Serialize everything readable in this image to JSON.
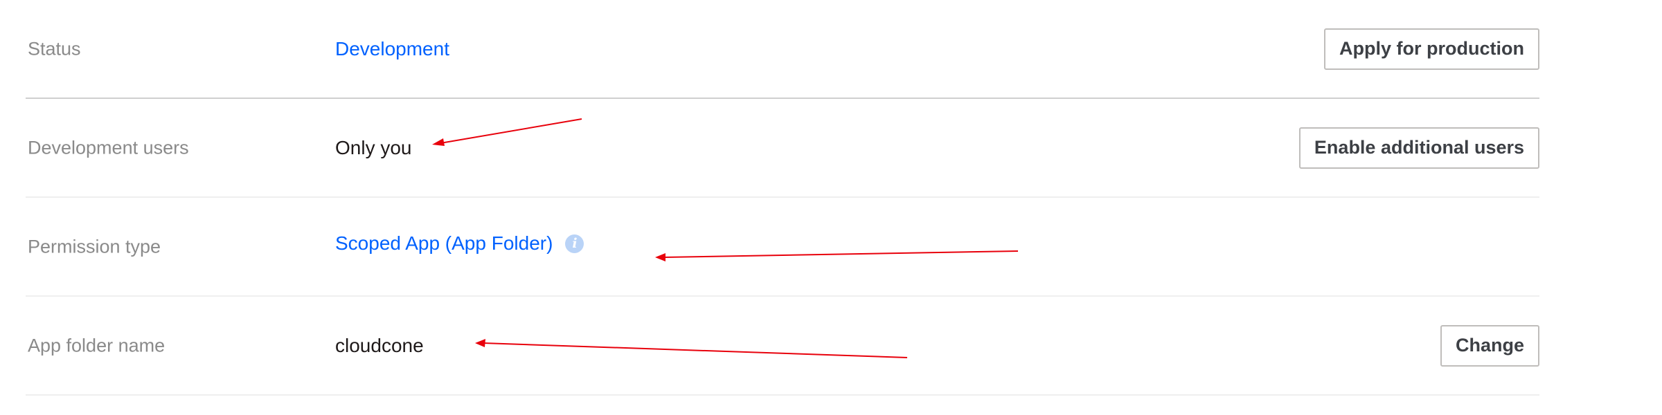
{
  "rows": [
    {
      "label": "Status",
      "value": "Development",
      "button": "Apply for production"
    },
    {
      "label": "Development users",
      "value": "Only you",
      "button": "Enable additional users"
    },
    {
      "label": "Permission type",
      "value": "Scoped App (App Folder)",
      "icon": "info-icon"
    },
    {
      "label": "App folder name",
      "value": "cloudcone",
      "button": "Change"
    }
  ],
  "colors": {
    "link": "#0061fe",
    "label": "#8a8a8a",
    "value": "#1e1919",
    "button_border": "#bfbdbb",
    "annotation_arrow": "#e8000b"
  }
}
